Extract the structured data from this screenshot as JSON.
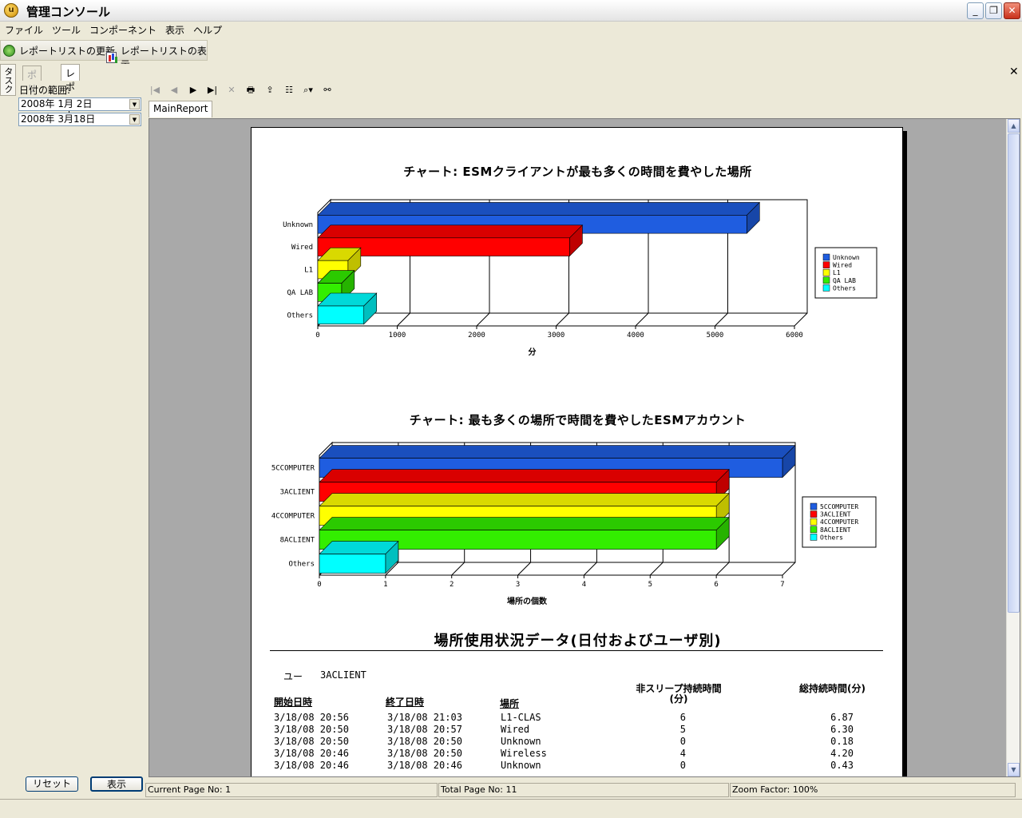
{
  "window": {
    "title": "管理コンソール",
    "icon": "app-logo-icon"
  },
  "menu": [
    "ファイル",
    "ツール",
    "コンポーネント",
    "表示",
    "ヘルプ"
  ],
  "toolbar": {
    "refresh_label": "レポートリストの更新",
    "show_label": "レポートリストの表示"
  },
  "side_tab": "タスク",
  "left": {
    "tabs": [
      "ポリシー",
      "レポート"
    ],
    "date_range_label": "日付の範囲:",
    "date_from": "2008年  1月  2日",
    "date_to": "2008年  3月18日",
    "reset_label": "リセット",
    "show_label": "表示"
  },
  "viewer": {
    "tab": "MainReport"
  },
  "report": {
    "chart1_title": "チャート: ESMクライアントが最も多くの時間を費やした場所",
    "chart2_title": "チャート: 最も多くの場所で時間を費やしたESMアカウント",
    "section_title": "場所使用状況データ(日付およびユーザ別)",
    "user_label": "ユー",
    "user_value": "3ACLIENT",
    "col_start": "開始日時",
    "col_end": "終了日時",
    "col_location": "場所",
    "col_nonsleep": "非スリープ持続時間(分)",
    "col_total": "総持続時間(分)",
    "rows": [
      {
        "start": "3/18/08  20:56",
        "end": "3/18/08  21:03",
        "loc": "L1-CLAS",
        "nonsleep": "6",
        "total": "6.87"
      },
      {
        "start": "3/18/08  20:50",
        "end": "3/18/08  20:57",
        "loc": "Wired",
        "nonsleep": "5",
        "total": "6.30"
      },
      {
        "start": "3/18/08  20:50",
        "end": "3/18/08  20:50",
        "loc": "Unknown",
        "nonsleep": "0",
        "total": "0.18"
      },
      {
        "start": "3/18/08  20:46",
        "end": "3/18/08  20:50",
        "loc": "Wireless",
        "nonsleep": "4",
        "total": "4.20"
      },
      {
        "start": "3/18/08  20:46",
        "end": "3/18/08  20:46",
        "loc": "Unknown",
        "nonsleep": "0",
        "total": "0.43"
      }
    ]
  },
  "status": {
    "current_page": "Current Page No: 1",
    "total_page": "Total Page No: 11",
    "zoom": "Zoom Factor: 100%"
  },
  "chart_data": [
    {
      "type": "bar",
      "orientation": "horizontal",
      "title": "チャート: ESMクライアントが最も多くの時間を費やした場所",
      "categories": [
        "Unknown",
        "Wired",
        "L1",
        "QA LAB",
        "Others"
      ],
      "values": [
        5400,
        3170,
        380,
        300,
        580
      ],
      "colors": [
        "#1f5de0",
        "#ff0000",
        "#ffff00",
        "#33ee00",
        "#00ffff"
      ],
      "xlabel": "分",
      "xlim": [
        0,
        6000
      ],
      "xticks": [
        "0",
        "1000",
        "2000",
        "3000",
        "4000",
        "5000",
        "6000"
      ],
      "legend": [
        "Unknown",
        "Wired",
        "L1",
        "QA LAB",
        "Others"
      ],
      "legend_position": "right",
      "grid": true
    },
    {
      "type": "bar",
      "orientation": "horizontal",
      "title": "チャート: 最も多くの場所で時間を費やしたESMアカウント",
      "categories": [
        "5CCOMPUTER",
        "3ACLIENT",
        "4CCOMPUTER",
        "8ACLIENT",
        "Others"
      ],
      "values": [
        7,
        6,
        6,
        6,
        1
      ],
      "colors": [
        "#1f5de0",
        "#ff0000",
        "#ffff00",
        "#33ee00",
        "#00ffff"
      ],
      "xlabel": "場所の個数",
      "xlim": [
        0,
        7
      ],
      "xticks": [
        "0",
        "1",
        "2",
        "3",
        "4",
        "5",
        "6",
        "7"
      ],
      "legend": [
        "5CCOMPUTER",
        "3ACLIENT",
        "4CCOMPUTER",
        "8ACLIENT",
        "Others"
      ],
      "legend_position": "right",
      "grid": true
    }
  ]
}
